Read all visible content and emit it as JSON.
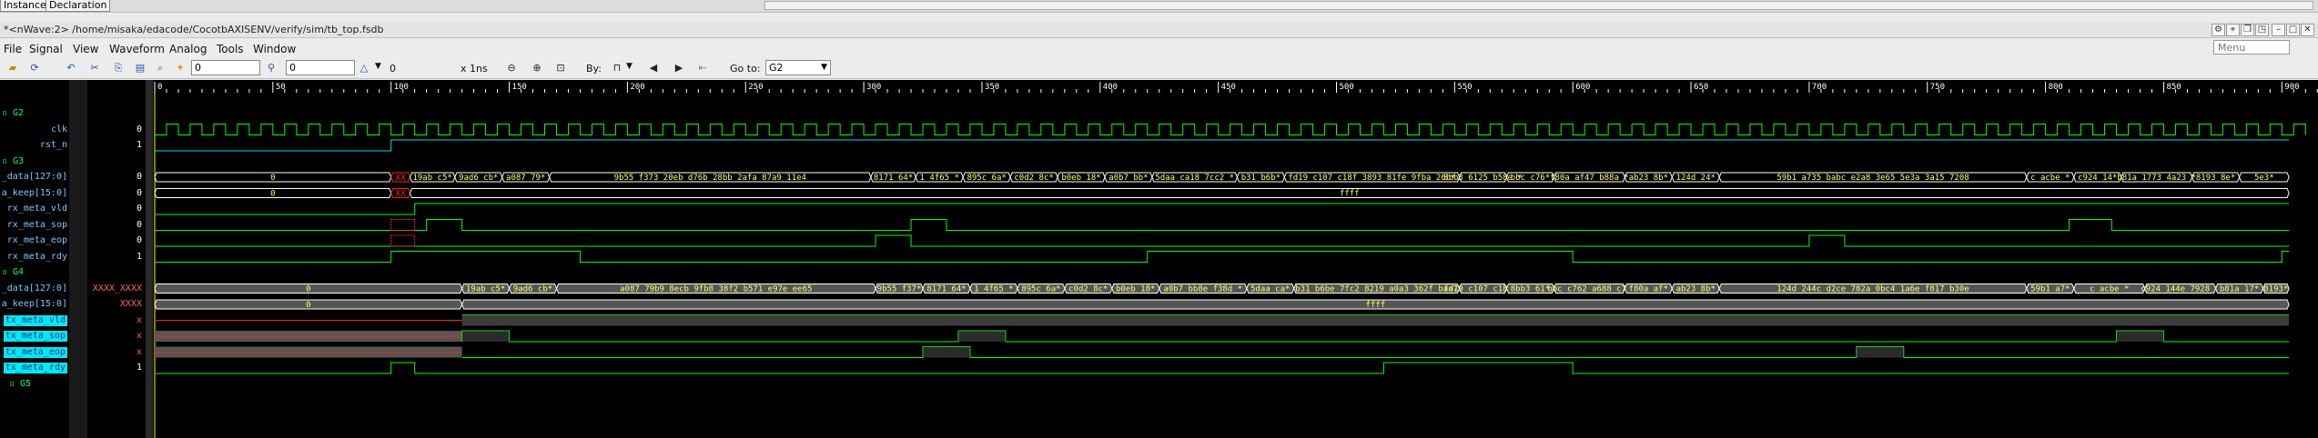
{
  "tabs": {
    "instance": "Instance",
    "declaration": "Declaration"
  },
  "window": {
    "title": "*<nWave:2> /home/misaka/edacode/CocotbAXISENV/verify/sim/tb_top.fsdb"
  },
  "menu": {
    "items": [
      "File",
      "Signal",
      "View",
      "Waveform",
      "Analog",
      "Tools",
      "Window"
    ],
    "search_placeholder": "Menu"
  },
  "toolbar": {
    "cursor_time": "0",
    "marker_time": "0",
    "delta_value": "0",
    "time_unit": "x 1ns",
    "by_label": "By:",
    "goto_label": "Go to:",
    "goto_value": "G2"
  },
  "timeline": {
    "ticks": [
      "0",
      "50",
      "100",
      "150",
      "200",
      "250",
      "300",
      "350",
      "400",
      "450",
      "500",
      "550",
      "600",
      "650",
      "700",
      "750",
      "800",
      "850",
      "900"
    ]
  },
  "signals": [
    {
      "name": "G2",
      "type": "group",
      "value": ""
    },
    {
      "name": "clk",
      "type": "clock",
      "value": "0"
    },
    {
      "name": "rst_n",
      "type": "bit",
      "value": "1"
    },
    {
      "name": "G3",
      "type": "group",
      "value": ""
    },
    {
      "name": "_data[127:0]",
      "type": "bus",
      "value": "0"
    },
    {
      "name": "a_keep[15:0]",
      "type": "bus",
      "value": "0"
    },
    {
      "name": "rx_meta_vld",
      "type": "bit",
      "value": "0"
    },
    {
      "name": "rx_meta_sop",
      "type": "bit",
      "value": "0"
    },
    {
      "name": "rx_meta_eop",
      "type": "bit",
      "value": "0"
    },
    {
      "name": "rx_meta_rdy",
      "type": "bit",
      "value": "1"
    },
    {
      "name": "G4",
      "type": "group",
      "value": ""
    },
    {
      "name": "_data[127:0]",
      "type": "bus",
      "value": "XXXX_XXXX"
    },
    {
      "name": "a_keep[15:0]",
      "type": "bus",
      "value": "XXXX"
    },
    {
      "name": "tx_meta_vld",
      "type": "bit",
      "value": "x"
    },
    {
      "name": "tx_meta_sop",
      "type": "bit",
      "value": "x"
    },
    {
      "name": "tx_meta_eop",
      "type": "bit",
      "value": "x"
    },
    {
      "name": "tx_meta_rdy",
      "type": "bit",
      "value": "1"
    },
    {
      "name": "G5",
      "type": "group",
      "value": ""
    }
  ],
  "rx_bus_labels": [
    "0",
    "XX",
    "19ab_c5*",
    "9ad6_cb*",
    "a087_79*",
    "9b55_f373_20eb_d76b_28bb_2afa_87a9_11e4",
    "8171_64*",
    "1_4f65_*",
    "895c_6a*",
    "c0d2_8c*",
    "b0eb_18*",
    "a0b7_bb*",
    "5daa_ca18_7cc2_*",
    "b31_b6b*",
    "fd19_c107_c18f_3893_81fe_9fba_26b*",
    "8bb3_6125_b58e_*",
    "bbc_c76*",
    "f80a_af47_b88a_*",
    "ab23_8b*",
    "124d_24*",
    "59b1_a735_babc_e2a8_3e65_5e3a_3a15_7208",
    "c_acbe_*",
    "c924_14*",
    "b81a_1773_4a23_*",
    "8193_8e*",
    "5e3*"
  ],
  "rx_keep_labels": [
    "0",
    "XX",
    "ffff"
  ],
  "tx_bus_labels": [
    "0",
    "19ab_c5*",
    "9ad6_cb*",
    "a087_79b9_8ecb_9fb8_38f2_b571_e97e_ee65",
    "9b55_f37*",
    "8171_64*",
    "1_4f65_*",
    "895c_6a*",
    "c0d2_8c*",
    "b0eb_18*",
    "a0b7_bb8e_f38d_*",
    "5daa_ca*",
    "b31_b6be_7fc2_8219_a0a3_362f_baa7",
    "fd19_c107_c18f_*",
    "8bb3_61*",
    "bbc_c762_a688_c7*",
    "f80a_af*",
    "ab23_8b*",
    "124d_244c_d2ce_782a_0bc4_1a6e_f817_b30e",
    "59b1_a7*",
    "c_acbe_*",
    "c924_144e_7928_*",
    "b81a_17*",
    "8193*"
  ],
  "tx_keep_labels": [
    "0",
    "ffff"
  ],
  "colors": {
    "wave_green": "#00ff00",
    "wave_cyan": "#00e0e0",
    "bus_text": "#ffff66",
    "unknown_red": "#ff2020",
    "unknown_fill": "#555555",
    "name_blue": "#7cc9ff",
    "group_green": "#00ff66",
    "selected_bg": "#00e8ff"
  },
  "icons": [
    "open-folder-icon",
    "reload-icon",
    "undo-icon",
    "cut-icon",
    "copy-icon",
    "paste-icon",
    "find-icon",
    "marker-icon",
    "zoom-out-icon",
    "zoom-in-icon",
    "zoom-fit-icon",
    "prev-edge-icon",
    "next-edge-icon",
    "search-signal-icon"
  ]
}
